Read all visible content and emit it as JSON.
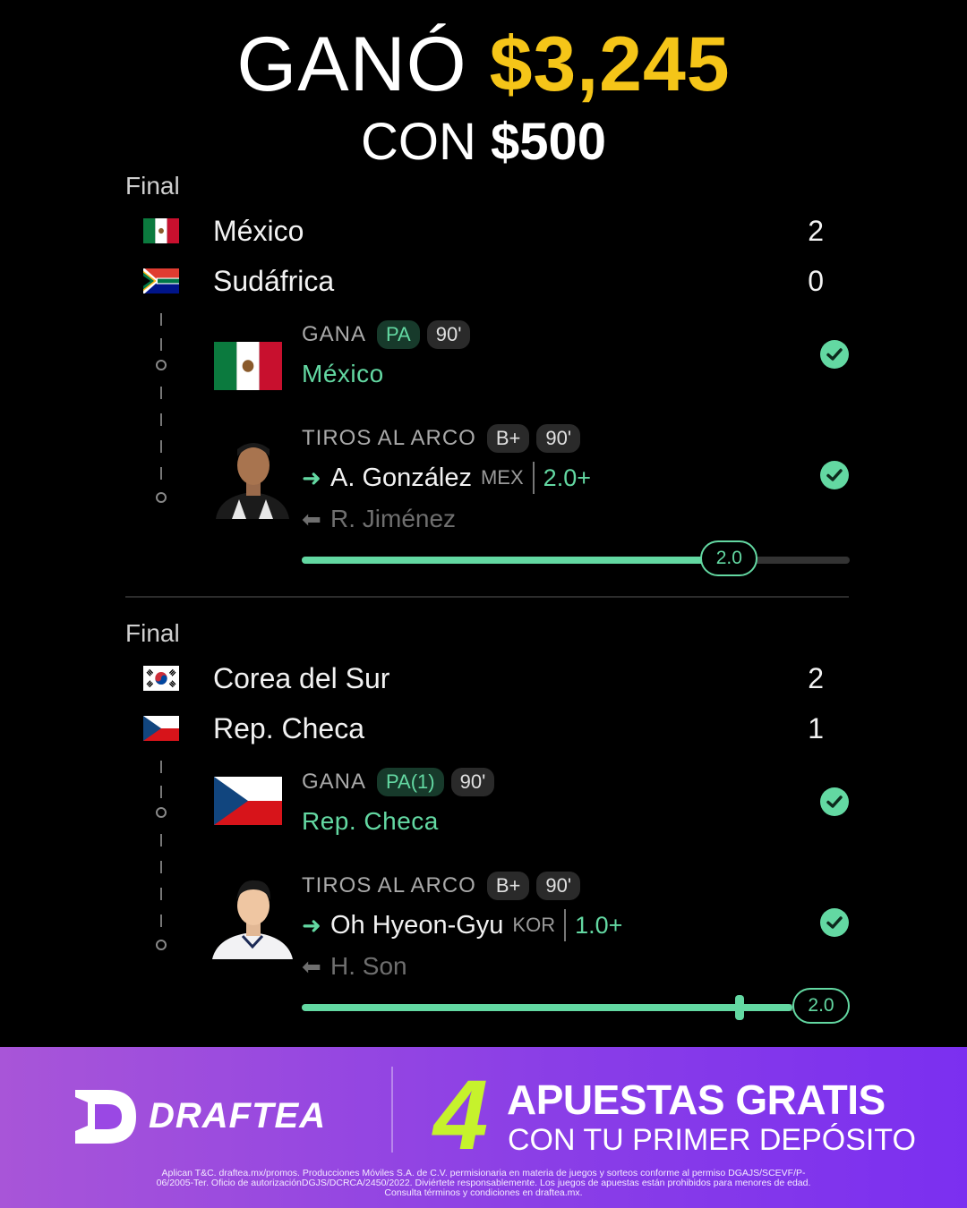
{
  "headline": {
    "lead": "GANÓ",
    "amount": "$3,245"
  },
  "subline": {
    "lead": "CON",
    "amount": "$500"
  },
  "matches": [
    {
      "status": "Final",
      "teams": [
        {
          "name": "México",
          "score": "2"
        },
        {
          "name": "Sudáfrica",
          "score": "0"
        }
      ],
      "win_pick": {
        "type": "GANA",
        "chips": [
          "PA",
          "90'"
        ],
        "team": "México",
        "result": "won"
      },
      "player_pick": {
        "type": "TIROS AL ARCO",
        "chips": [
          "B+",
          "90'"
        ],
        "player": "A. González",
        "country": "MEX",
        "line": "2.0+",
        "replaced": "R. Jiménez",
        "result": "won",
        "progress": {
          "value_label": "2.0",
          "target": 2.0,
          "fraction": 0.78
        }
      }
    },
    {
      "status": "Final",
      "teams": [
        {
          "name": "Corea del Sur",
          "score": "2"
        },
        {
          "name": "Rep. Checa",
          "score": "1"
        }
      ],
      "win_pick": {
        "type": "GANA",
        "chips": [
          "PA(1)",
          "90'"
        ],
        "team": "Rep. Checa",
        "result": "won"
      },
      "player_pick": {
        "type": "TIROS AL ARCO",
        "chips": [
          "B+",
          "90'"
        ],
        "player": "Oh Hyeon-Gyu",
        "country": "KOR",
        "line": "1.0+",
        "replaced": "H. Son",
        "result": "won",
        "progress": {
          "value_label": "2.0",
          "target": 1.0,
          "fraction": 1.0
        }
      }
    }
  ],
  "banner": {
    "brand": "DRAFTEA",
    "promo_number": "4",
    "promo_title": "APUESTAS GRATIS",
    "promo_sub": "CON TU PRIMER DEPÓSITO",
    "legal": "Aplican T&C. draftea.mx/promos. Producciones Móviles S.A. de C.V. permisionaria en materia de juegos y sorteos conforme al permiso DGAJS/SCEVF/P-06/2005-Ter. Oficio de autorizaciónDGJS/DCRCA/2450/2022. Diviértete responsablemente. Los juegos de apuestas están prohibidos para menores de edad. Consulta términos y condiciones en draftea.mx."
  },
  "colors": {
    "accent_green": "#63d8a2",
    "gold": "#F5C518",
    "promo_lime": "#c6f22c",
    "banner_purple": "#8b3fe6"
  },
  "icons": [
    "mexico-flag-icon",
    "south-africa-flag-icon",
    "south-korea-flag-icon",
    "czech-flag-icon",
    "check-icon",
    "arrow-right-icon",
    "arrow-left-icon",
    "draftea-logo-icon"
  ]
}
